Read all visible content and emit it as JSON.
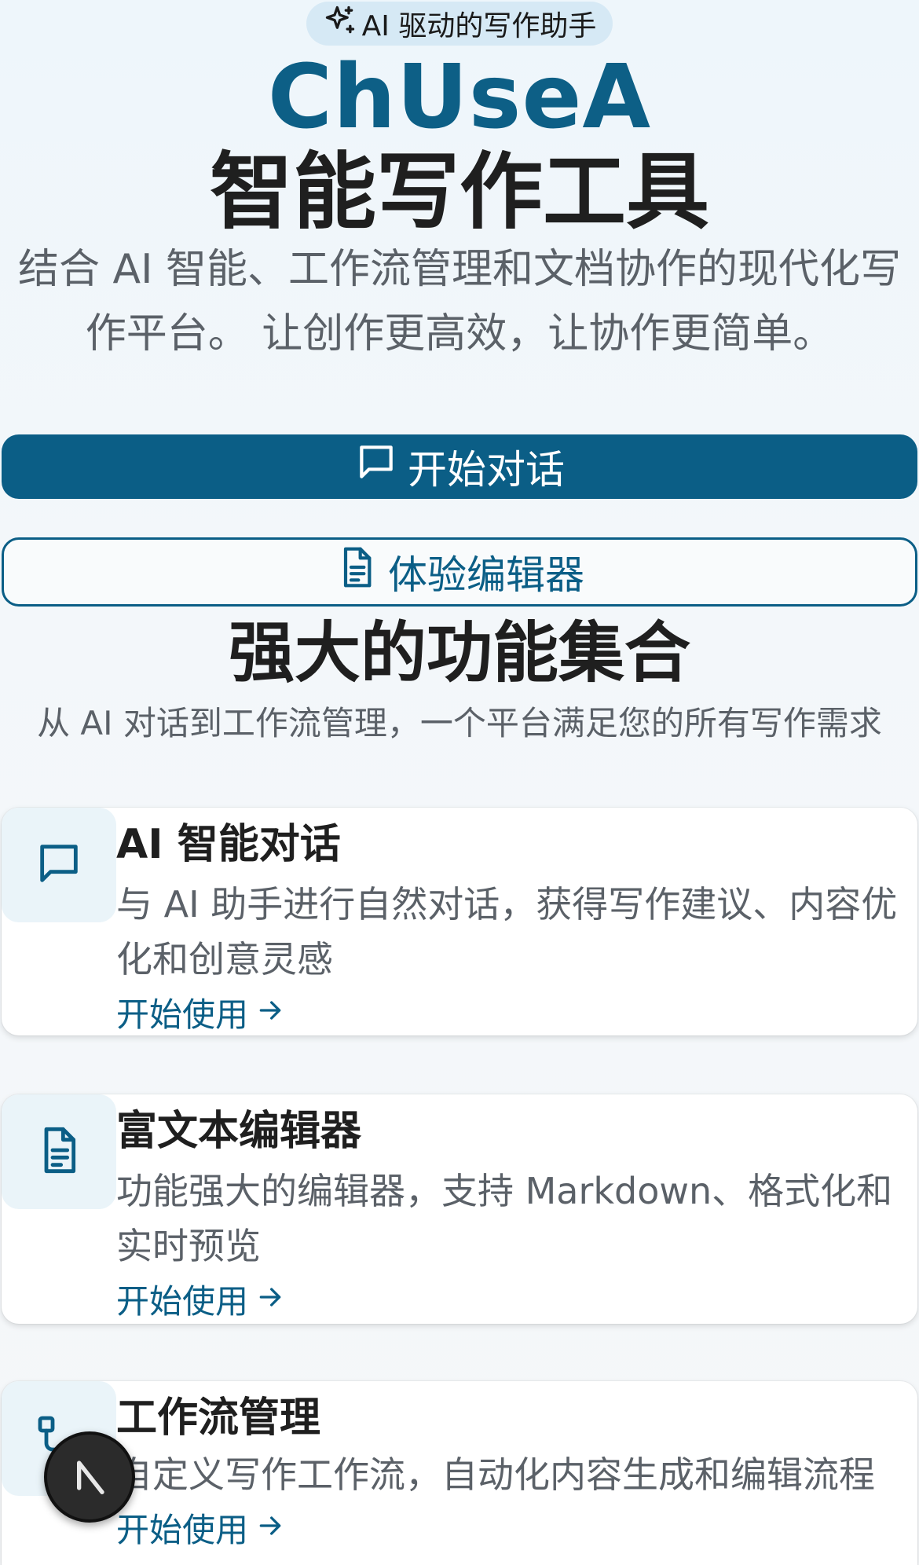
{
  "hero": {
    "badge": "AI 驱动的写作助手",
    "brand": "ChUseA",
    "headline": "智能写作工具",
    "subtitle": "结合 AI 智能、工作流管理和文档协作的现代化写作平台。 让创作更高效，让协作更简单。",
    "primary_button": "开始对话",
    "secondary_button": "体验编辑器"
  },
  "features": {
    "title": "强大的功能集合",
    "subtitle": "从 AI 对话到工作流管理，一个平台满足您的所有写作需求",
    "cards": [
      {
        "icon": "message-square-icon",
        "title": "AI 智能对话",
        "description": "与 AI 助手进行自然对话，获得写作建议、内容优化和创意灵感",
        "link": "开始使用"
      },
      {
        "icon": "file-text-icon",
        "title": "富文本编辑器",
        "description": "功能强大的编辑器，支持 Markdown、格式化和实时预览",
        "link": "开始使用"
      },
      {
        "icon": "workflow-icon",
        "title": "工作流管理",
        "description": "自定义写作工作流，自动化内容生成和编辑流程",
        "link": "开始使用"
      }
    ]
  },
  "colors": {
    "accent": "#0b5e86",
    "brand_text": "#0d5f86",
    "icon_bg": "#eaf4f9"
  }
}
